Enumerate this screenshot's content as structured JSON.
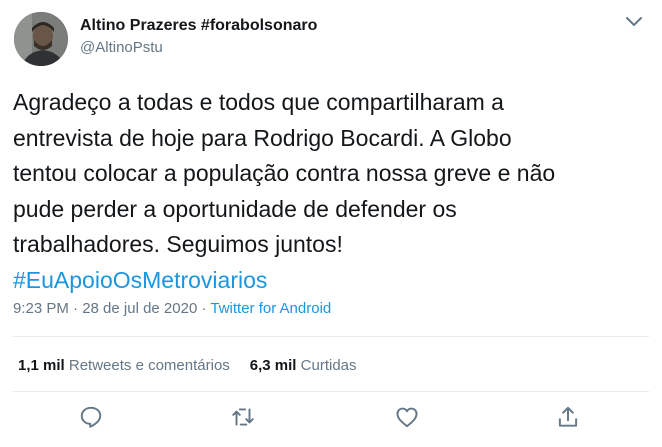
{
  "tweet": {
    "display_name": "Altino Prazeres #forabolsonaro",
    "handle": "@AltinoPstu",
    "text_lines": [
      "Agradeço a todas e todos que compartilharam a",
      "entrevista de hoje para Rodrigo Bocardi.  A Globo",
      "tentou colocar a população contra nossa greve e  não",
      "pude perder a oportunidade de defender os",
      "trabalhadores. Seguimos juntos!"
    ],
    "hashtag": "#EuApoioOsMetroviarios",
    "timestamp": "9:23 PM · 28 de jul de 2020 · ",
    "source": "Twitter for Android",
    "retweets_count": "1,1 mil",
    "retweets_label": "Retweets e comentários",
    "likes_count": "6,3 mil",
    "likes_label": "Curtidas"
  },
  "icons": {
    "menu": "chevron-down-icon",
    "reply": "reply-icon",
    "retweet": "retweet-icon",
    "like": "heart-icon",
    "share": "share-icon"
  },
  "colors": {
    "link": "#1b95e0",
    "secondary_text": "#657786",
    "icon": "#657786",
    "divider": "#e6ecf0"
  }
}
